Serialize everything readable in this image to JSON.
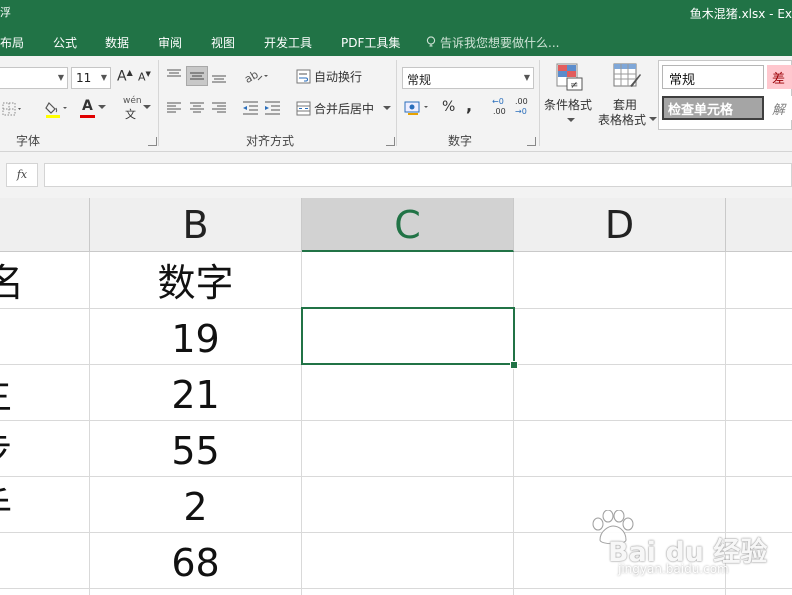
{
  "window": {
    "title": "鱼木混猪.xlsx - Ex"
  },
  "tabs": [
    {
      "label": "布局"
    },
    {
      "label": "公式"
    },
    {
      "label": "数据"
    },
    {
      "label": "审阅"
    },
    {
      "label": "视图"
    },
    {
      "label": "开发工具"
    },
    {
      "label": "PDF工具集"
    }
  ],
  "tellme": {
    "placeholder": "告诉我您想要做什么..."
  },
  "ribbon": {
    "font": {
      "size": "11",
      "group_label": "字体",
      "increase": "A",
      "decrease": "A",
      "font_color_glyph": "A",
      "phonetic_top": "wén",
      "phonetic_bottom": "文"
    },
    "alignment": {
      "wrap_text": "自动换行",
      "merge_center": "合并后居中",
      "group_label": "对齐方式"
    },
    "number": {
      "format": "常规",
      "percent": "%",
      "comma": ",",
      "inc_decimal_top": "←0",
      "inc_decimal_bottom": ".00",
      "dec_decimal_top": ".00",
      "dec_decimal_bottom": "→0",
      "group_label": "数字"
    },
    "styles": {
      "conditional_format": "条件格式",
      "format_table_line1": "套用",
      "format_table_line2": "表格格式",
      "normal": "常规",
      "bad": "差",
      "check_cell": "检查单元格",
      "explanatory": "解"
    }
  },
  "formula_bar": {
    "fx": "fx",
    "value": ""
  },
  "sheet": {
    "columns": [
      "B",
      "C",
      "D"
    ],
    "selected_column": "C",
    "header_row": {
      "a_partial": "名",
      "b": "数字"
    },
    "rows": [
      {
        "a_partial": ".",
        "b": "19"
      },
      {
        "a_partial": "主",
        "b": "21"
      },
      {
        "a_partial": "步",
        "b": "55"
      },
      {
        "a_partial": "手",
        "b": "2"
      },
      {
        "a_partial": ".",
        "b": "68"
      }
    ]
  },
  "watermark": {
    "logo": "Bai du 经验",
    "url": "jingyan.baidu.com"
  },
  "colors": {
    "accent": "#217346",
    "ribbon": "#f3f3f3",
    "bad_fill": "#ffc7ce",
    "bad_text": "#9c0006",
    "check_fill": "#a5a5a5"
  }
}
